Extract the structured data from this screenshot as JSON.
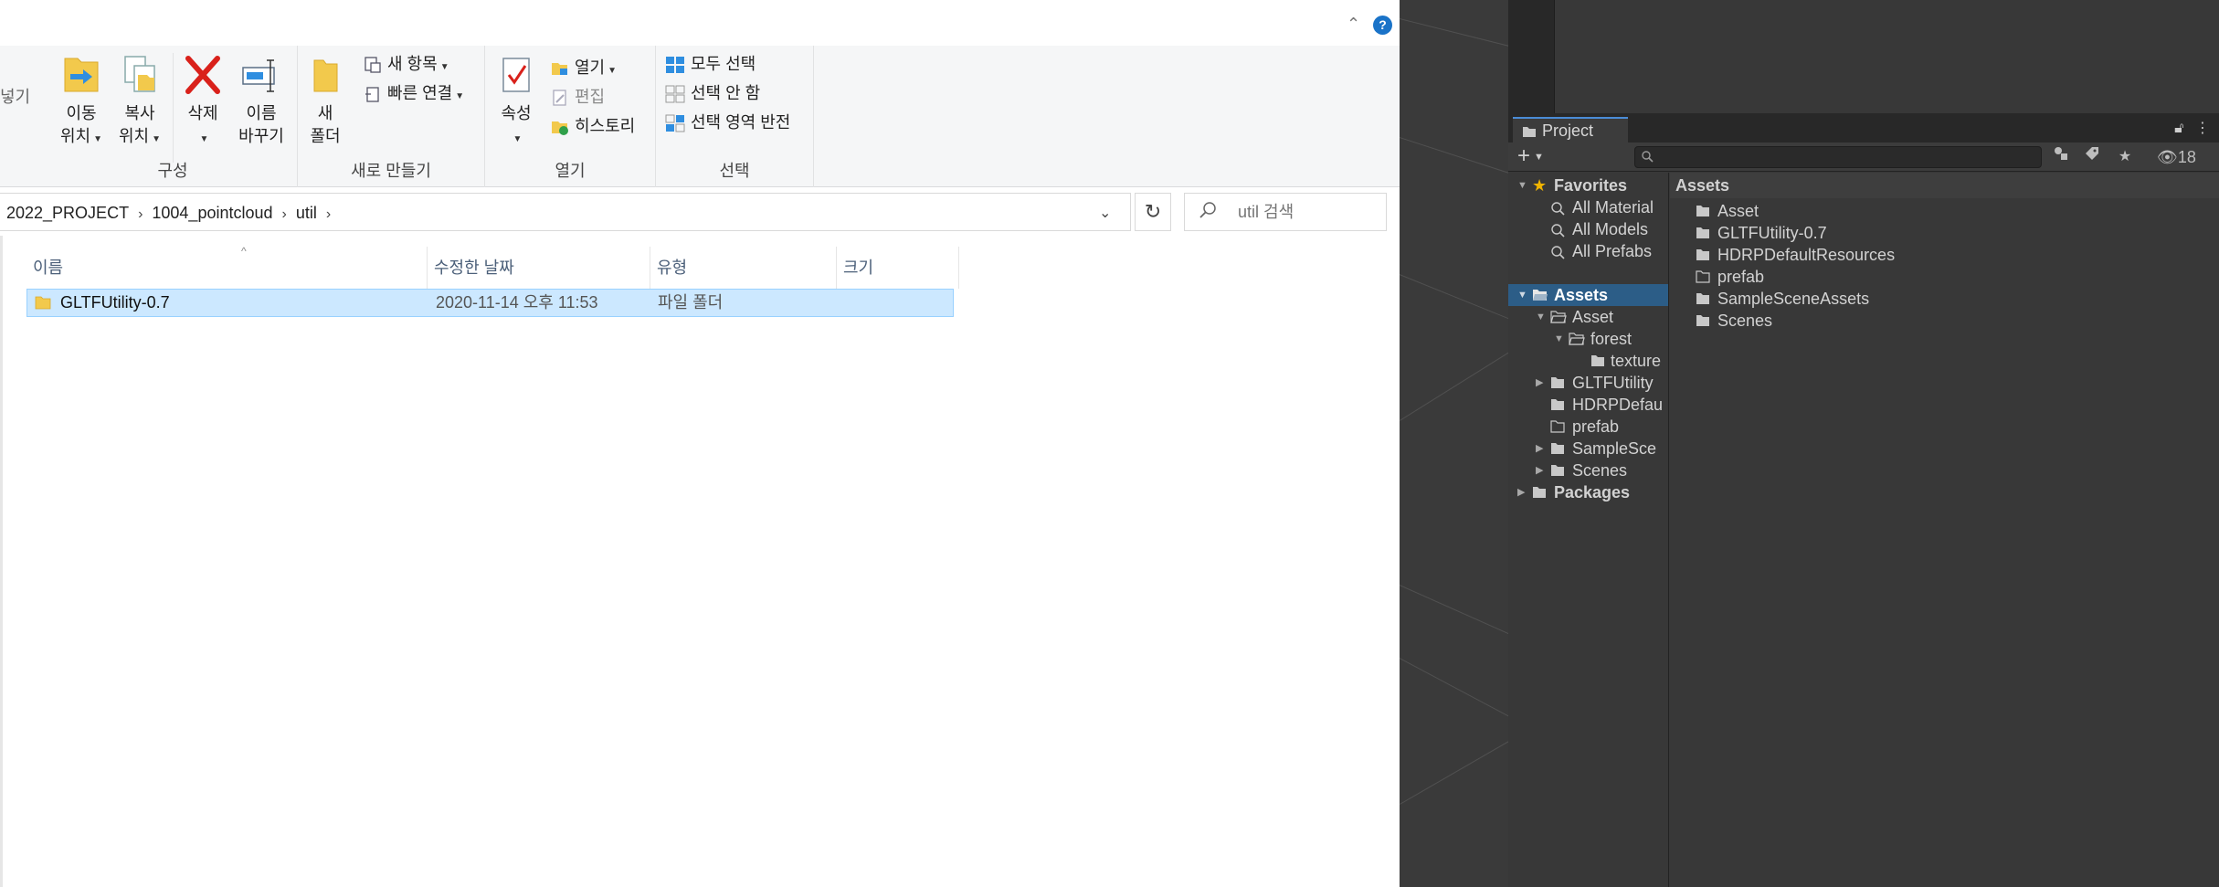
{
  "explorer": {
    "ribbon": {
      "partial_left_label": "넣기",
      "groups": {
        "organize": {
          "label": "구성",
          "move_to": {
            "line1": "이동",
            "line2": "위치"
          },
          "copy_to": {
            "line1": "복사",
            "line2": "위치"
          },
          "delete": "삭제",
          "rename": {
            "line1": "이름",
            "line2": "바꾸기"
          }
        },
        "new": {
          "label": "새로 만들기",
          "new_folder": {
            "line1": "새",
            "line2": "폴더"
          },
          "new_item": "새 항목",
          "easy_access": "빠른 연결"
        },
        "open": {
          "label": "열기",
          "properties": "속성",
          "open": "열기",
          "edit": "편집",
          "history": "히스토리"
        },
        "select": {
          "label": "선택",
          "select_all": "모두 선택",
          "select_none": "선택 안 함",
          "invert_selection": "선택 영역 반전"
        }
      }
    },
    "address": {
      "crumbs": [
        "2022_PROJECT",
        "1004_pointcloud",
        "util"
      ],
      "search_placeholder": "util 검색"
    },
    "columns": [
      "이름",
      "수정한 날짜",
      "유형",
      "크기"
    ],
    "files": [
      {
        "name": "GLTFUtility-0.7",
        "modified": "2020-11-14 오후 11:53",
        "type": "파일 폴더",
        "size": ""
      }
    ]
  },
  "unity": {
    "project_tab": "Project",
    "hidden_count": "18",
    "tree": {
      "favorites": "Favorites",
      "favorite_items": [
        "All Material",
        "All Models",
        "All Prefabs"
      ],
      "assets": "Assets",
      "asset": "Asset",
      "forest": "forest",
      "texture": "texture",
      "gltf": "GLTFUtility",
      "hdrp": "HDRPDefau",
      "prefab": "prefab",
      "sample": "SampleSce",
      "scenes": "Scenes",
      "packages": "Packages"
    },
    "assets_view": {
      "header": "Assets",
      "items": [
        "Asset",
        "GLTFUtility-0.7",
        "HDRPDefaultResources",
        "prefab",
        "SampleSceneAssets",
        "Scenes"
      ]
    }
  },
  "colors": {
    "selection_bg": "#cce8ff",
    "selection_border": "#99d1ff",
    "unity_select": "#2c5d87",
    "unity_panel": "#383838",
    "folder_yellow": "#f2c94c",
    "accent_blue": "#1a73c8"
  }
}
